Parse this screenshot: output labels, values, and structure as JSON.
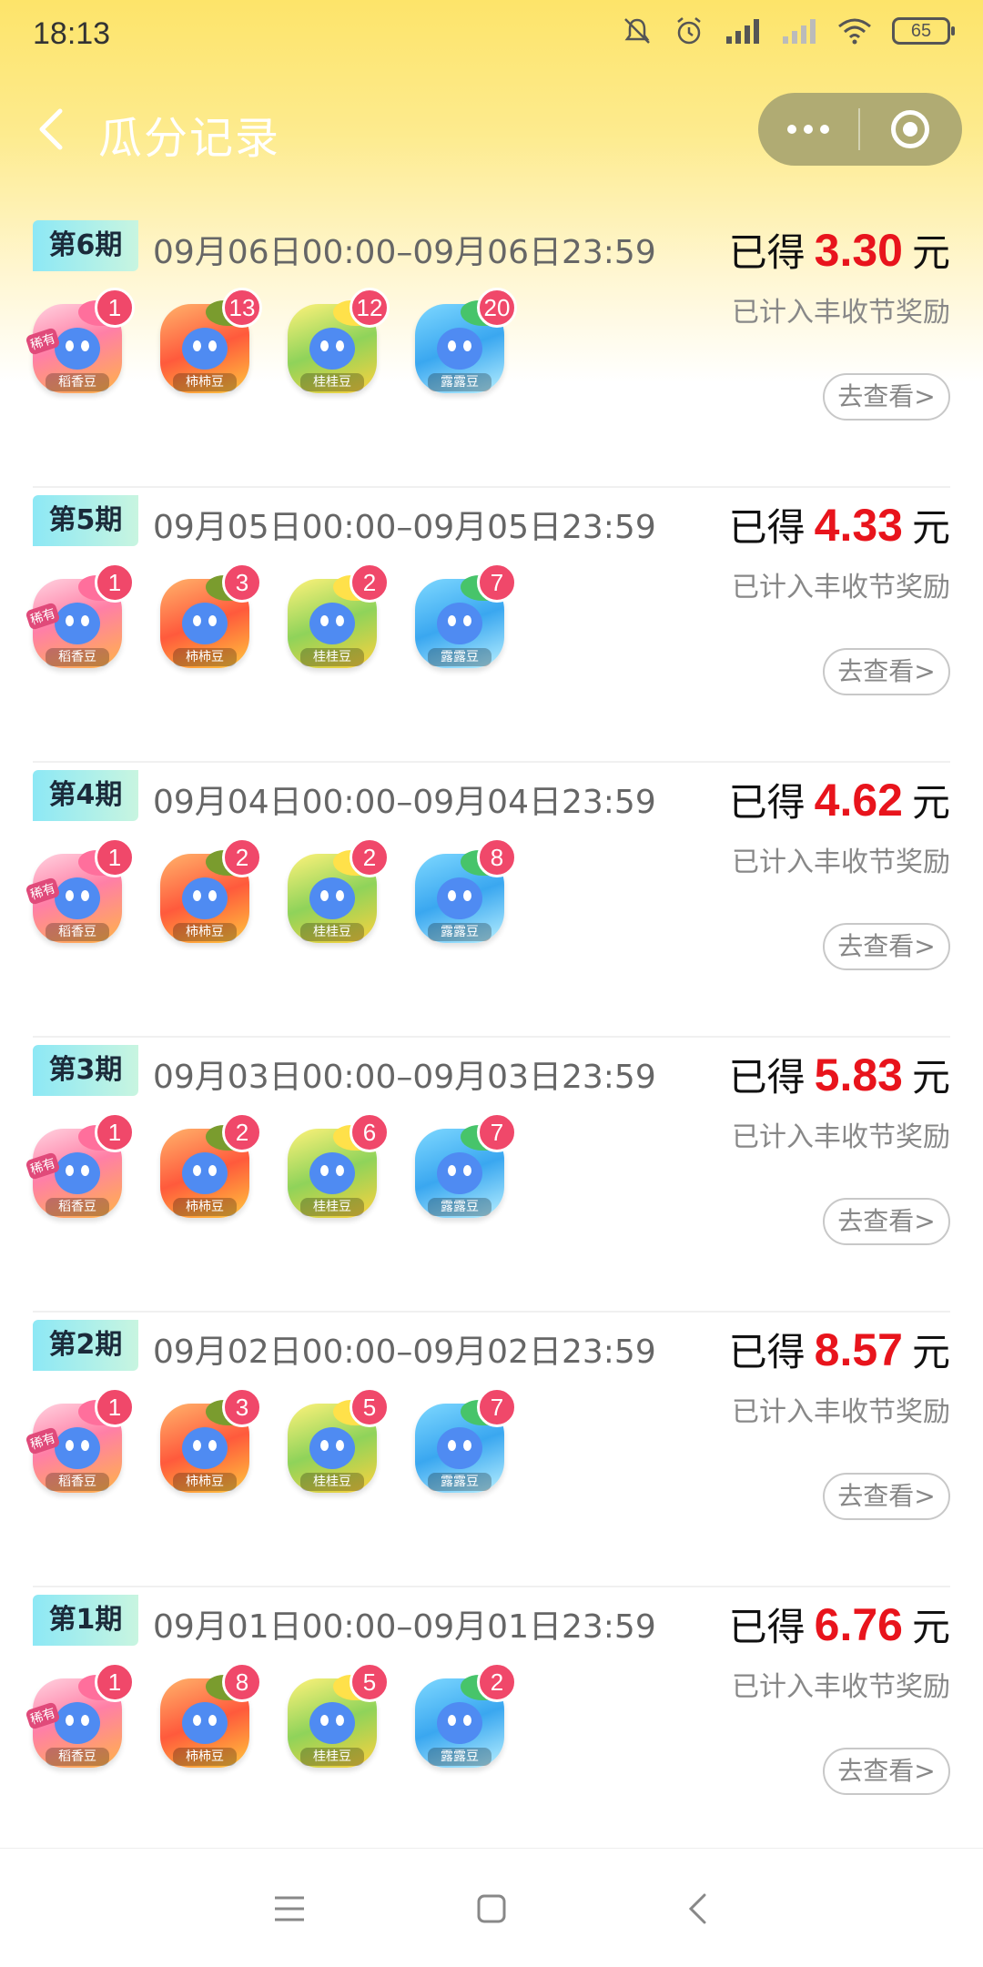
{
  "status_bar": {
    "time": "18:13",
    "battery": "65"
  },
  "header": {
    "title": "瓜分记录"
  },
  "bean_names": [
    "稻香豆",
    "柿柿豆",
    "桂桂豆",
    "露露豆"
  ],
  "rare_tag": "稀有",
  "records": [
    {
      "period": "第6期",
      "time_range": "09月06日00:00–09月06日23:59",
      "earn_prefix": "已得",
      "amount": "3.30",
      "unit": "元",
      "note": "已计入丰收节奖励",
      "button": "去查看>",
      "counts": [
        "1",
        "13",
        "12",
        "20"
      ]
    },
    {
      "period": "第5期",
      "time_range": "09月05日00:00–09月05日23:59",
      "earn_prefix": "已得",
      "amount": "4.33",
      "unit": "元",
      "note": "已计入丰收节奖励",
      "button": "去查看>",
      "counts": [
        "1",
        "3",
        "2",
        "7"
      ]
    },
    {
      "period": "第4期",
      "time_range": "09月04日00:00–09月04日23:59",
      "earn_prefix": "已得",
      "amount": "4.62",
      "unit": "元",
      "note": "已计入丰收节奖励",
      "button": "去查看>",
      "counts": [
        "1",
        "2",
        "2",
        "8"
      ]
    },
    {
      "period": "第3期",
      "time_range": "09月03日00:00–09月03日23:59",
      "earn_prefix": "已得",
      "amount": "5.83",
      "unit": "元",
      "note": "已计入丰收节奖励",
      "button": "去查看>",
      "counts": [
        "1",
        "2",
        "6",
        "7"
      ]
    },
    {
      "period": "第2期",
      "time_range": "09月02日00:00–09月02日23:59",
      "earn_prefix": "已得",
      "amount": "8.57",
      "unit": "元",
      "note": "已计入丰收节奖励",
      "button": "去查看>",
      "counts": [
        "1",
        "3",
        "5",
        "7"
      ]
    },
    {
      "period": "第1期",
      "time_range": "09月01日00:00–09月01日23:59",
      "earn_prefix": "已得",
      "amount": "6.76",
      "unit": "元",
      "note": "已计入丰收节奖励",
      "button": "去查看>",
      "counts": [
        "1",
        "8",
        "5",
        "2"
      ]
    }
  ],
  "colors": {
    "amount": "#e8141c",
    "count_badge": "#f0486a",
    "header_bg": "#fde46a",
    "capsule": "#b0ab73"
  }
}
